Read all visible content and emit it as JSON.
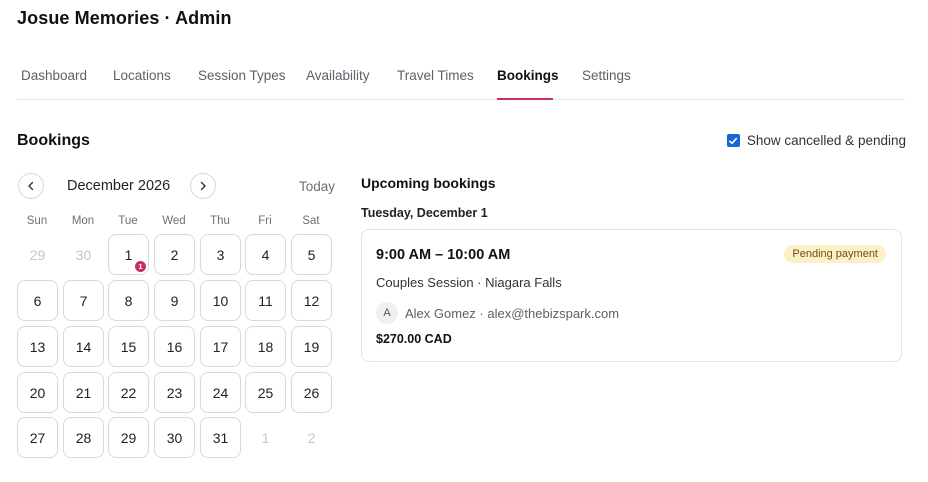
{
  "app": {
    "title": "Josue Memories · Admin"
  },
  "tabs": [
    {
      "label": "Dashboard"
    },
    {
      "label": "Locations"
    },
    {
      "label": "Session Types"
    },
    {
      "label": "Availability"
    },
    {
      "label": "Travel Times"
    },
    {
      "label": "Bookings",
      "active": true
    },
    {
      "label": "Settings"
    }
  ],
  "bookings": {
    "title": "Bookings",
    "show_cancelled": {
      "label": "Show cancelled & pending",
      "checked": true
    }
  },
  "calendar": {
    "month_label": "December 2026",
    "today_label": "Today",
    "weekdays": [
      "Sun",
      "Mon",
      "Tue",
      "Wed",
      "Thu",
      "Fri",
      "Sat"
    ],
    "weeks": [
      [
        {
          "d": "29",
          "muted": true
        },
        {
          "d": "30",
          "muted": true
        },
        {
          "d": "1",
          "badge": "1"
        },
        {
          "d": "2"
        },
        {
          "d": "3"
        },
        {
          "d": "4"
        },
        {
          "d": "5"
        }
      ],
      [
        {
          "d": "6"
        },
        {
          "d": "7"
        },
        {
          "d": "8"
        },
        {
          "d": "9"
        },
        {
          "d": "10"
        },
        {
          "d": "11"
        },
        {
          "d": "12"
        }
      ],
      [
        {
          "d": "13"
        },
        {
          "d": "14"
        },
        {
          "d": "15"
        },
        {
          "d": "16"
        },
        {
          "d": "17"
        },
        {
          "d": "18"
        },
        {
          "d": "19"
        }
      ],
      [
        {
          "d": "20"
        },
        {
          "d": "21"
        },
        {
          "d": "22"
        },
        {
          "d": "23"
        },
        {
          "d": "24"
        },
        {
          "d": "25"
        },
        {
          "d": "26"
        }
      ],
      [
        {
          "d": "27"
        },
        {
          "d": "28"
        },
        {
          "d": "29"
        },
        {
          "d": "30"
        },
        {
          "d": "31"
        },
        {
          "d": "1",
          "muted": true
        },
        {
          "d": "2",
          "muted": true
        }
      ]
    ],
    "prev_icon": "chevron-left-icon",
    "next_icon": "chevron-right-icon",
    "badge_color": "#c7305d"
  },
  "upcoming": {
    "title": "Upcoming bookings",
    "date_heading": "Tuesday, December 1",
    "booking": {
      "time": "9:00 AM – 10:00 AM",
      "status": "Pending payment",
      "session": "Couples Session · Niagara Falls",
      "avatar_initial": "A",
      "client": "Alex Gomez · alex@thebizspark.com",
      "price": "$270.00 CAD"
    }
  },
  "colors": {
    "accent": "#c7305d",
    "checkbox": "#1a66d6",
    "badge_bg": "#fbf0c6"
  }
}
